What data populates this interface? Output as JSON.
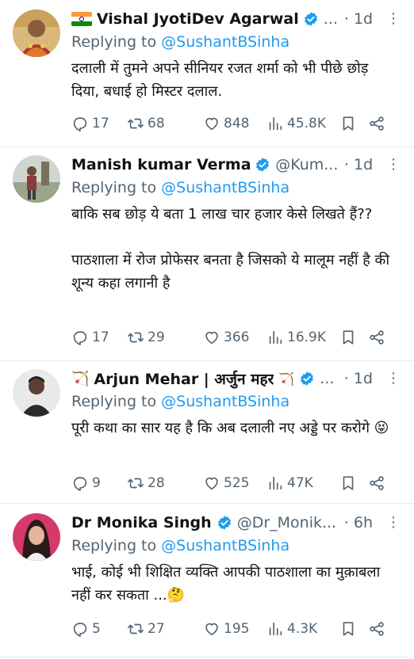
{
  "tweets": [
    {
      "name": "Vishal JyotiDev Agarwal",
      "handle": "...",
      "time": "· 1d",
      "replying_prefix": "Replying to ",
      "replying_to": "@SushantBSinha",
      "text": "दलाली में तुमने अपने सीनियर रजत शर्मा को भी पीछे छोड़ दिया, बधाई हो मिस्टर दलाल.",
      "replies": "17",
      "retweets": "68",
      "likes": "848",
      "views": "45.8K"
    },
    {
      "name": "Manish kumar Verma",
      "handle": "@Kum...",
      "time": "· 1d",
      "replying_prefix": "Replying to ",
      "replying_to": "@SushantBSinha",
      "text": "बाकि सब छोड़ ये बता 1 लाख चार हजार केसे लिखते हैं??\n\nपाठशाला में रोज प्रोफेसर बनता है जिसको ये मालूम नहीं है की शून्य कहा लगानी है",
      "replies": "17",
      "retweets": "29",
      "likes": "366",
      "views": "16.9K"
    },
    {
      "name": "Arjun Mehar | अर्जुन महर",
      "handle": "...",
      "time": "· 1d",
      "replying_prefix": "Replying to ",
      "replying_to": "@SushantBSinha",
      "text": "पूरी कथा का सार यह है कि अब दलाली नए अड्डे पर करोगे 😝",
      "replies": "9",
      "retweets": "28",
      "likes": "525",
      "views": "47K"
    },
    {
      "name": "Dr Monika Singh",
      "handle": "@Dr_Monik...",
      "time": "· 6h",
      "replying_prefix": "Replying to ",
      "replying_to": "@SushantBSinha",
      "text": "भाई, कोई भी शिक्षित व्यक्ति आपकी पाठशाला का मुक़ाबला नहीं कर सकता ...🤔",
      "replies": "5",
      "retweets": "27",
      "likes": "195",
      "views": "4.3K"
    }
  ],
  "icons": {
    "reply": "reply-icon",
    "retweet": "retweet-icon",
    "like": "heart-icon",
    "views": "views-icon",
    "bookmark": "bookmark-icon",
    "share": "share-icon",
    "verified": "verified-badge-icon",
    "more": "more-icon"
  },
  "colors": {
    "accent": "#1d9bf0",
    "secondary_text": "#536471",
    "primary_text": "#0f1419"
  }
}
